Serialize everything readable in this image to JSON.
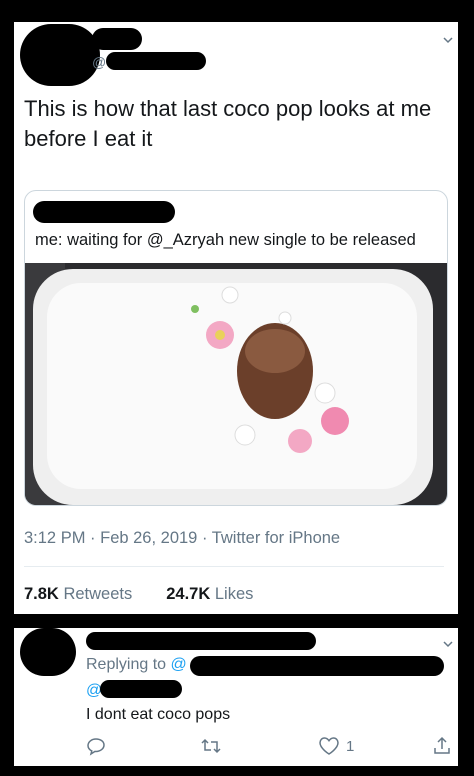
{
  "tweet": {
    "handle_prefix": "@",
    "text": "This is how that last coco pop looks at me before I eat it",
    "quote": {
      "text": "me: waiting for @_Azryah new single to be released"
    },
    "meta": "3:12 PM · Feb 26, 2019 · Twitter for iPhone",
    "retweets_count": "7.8K",
    "retweets_label": "Retweets",
    "likes_count": "24.7K",
    "likes_label": "Likes"
  },
  "reply": {
    "replying_label": "Replying to",
    "at_1": "@",
    "at_2": "@",
    "text": "I dont eat coco pops",
    "like_count": "1"
  },
  "colors": {
    "text": "#14171a",
    "secondary": "#657786",
    "link": "#1da1f2",
    "border": "#ccd6dd"
  }
}
